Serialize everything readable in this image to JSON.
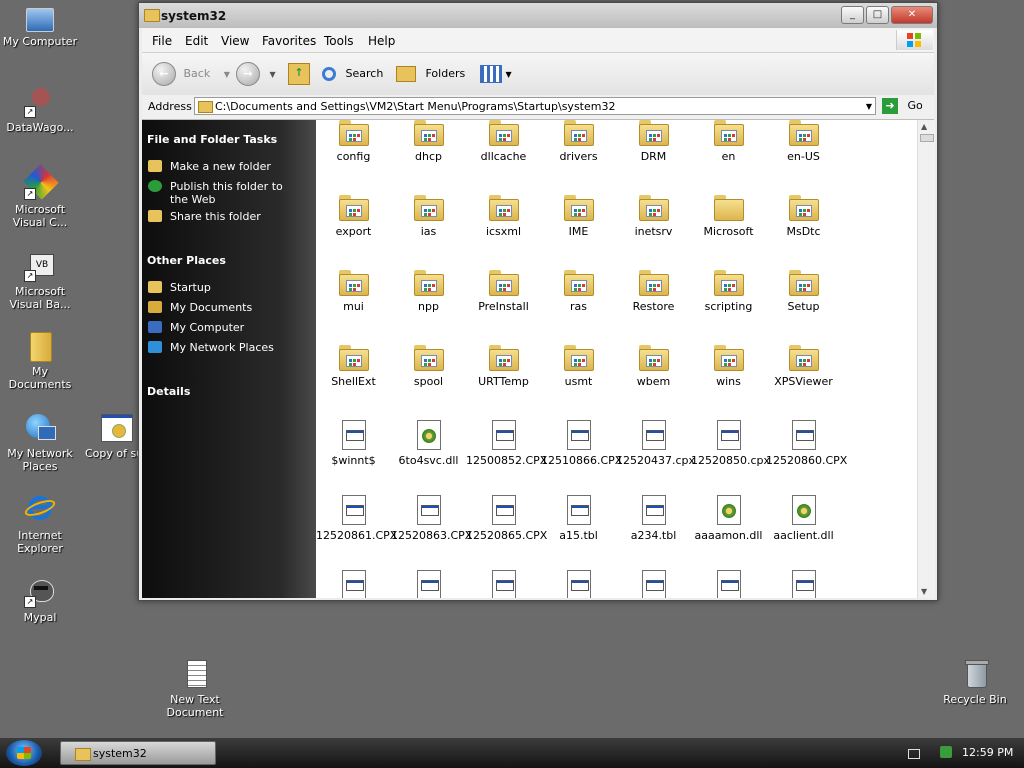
{
  "desktop": {
    "icons": [
      {
        "name": "my-computer",
        "label": "My Computer"
      },
      {
        "name": "datawago",
        "label": "DataWago..."
      },
      {
        "name": "ms-visual-c",
        "label": "Microsoft Visual C..."
      },
      {
        "name": "ms-visual-ba",
        "label": "Microsoft Visual Ba..."
      },
      {
        "name": "my-documents",
        "label": "My Documents"
      },
      {
        "name": "my-network-places",
        "label": "My Network Places"
      },
      {
        "name": "copy-of",
        "label": "Copy of su"
      },
      {
        "name": "internet-explorer",
        "label": "Internet Explorer"
      },
      {
        "name": "mypal",
        "label": "Mypal"
      },
      {
        "name": "new-text-document",
        "label": "New Text Document"
      },
      {
        "name": "recycle-bin",
        "label": "Recycle Bin"
      }
    ]
  },
  "window": {
    "title": "system32",
    "menu": [
      "File",
      "Edit",
      "View",
      "Favorites",
      "Tools",
      "Help"
    ],
    "toolbar": {
      "back": "Back",
      "search": "Search",
      "folders": "Folders"
    },
    "address": {
      "label": "Address",
      "value": "C:\\Documents and Settings\\VM2\\Start Menu\\Programs\\Startup\\system32",
      "go": "Go"
    },
    "left_pane": {
      "tasks_title": "File and Folder Tasks",
      "tasks": [
        "Make a new folder",
        "Publish this folder to the Web",
        "Share this folder"
      ],
      "places_title": "Other Places",
      "places": [
        "Startup",
        "My Documents",
        "My Computer",
        "My Network Places"
      ],
      "details_title": "Details"
    },
    "items": [
      "config",
      "dhcp",
      "dllcache",
      "drivers",
      "DRM",
      "en",
      "en-US",
      "export",
      "ias",
      "icsxml",
      "IME",
      "inetsrv",
      "Microsoft",
      "MsDtc",
      "mui",
      "npp",
      "PreInstall",
      "ras",
      "Restore",
      "scripting",
      "Setup",
      "ShellExt",
      "spool",
      "URTTemp",
      "usmt",
      "wbem",
      "wins",
      "XPSViewer",
      "$winnt$",
      "6to4svc.dll",
      "12500852.CPX",
      "12510866.CPX",
      "12520437.cpx",
      "12520850.cpx",
      "12520860.CPX",
      "12520861.CPX",
      "12520863.CPX",
      "12520865.CPX",
      "a15.tbl",
      "a234.tbl",
      "aaaamon.dll",
      "aaclient.dll",
      "",
      "",
      "",
      "",
      "",
      "",
      ""
    ]
  },
  "taskbar": {
    "task": "system32",
    "clock": "12:59 PM"
  }
}
